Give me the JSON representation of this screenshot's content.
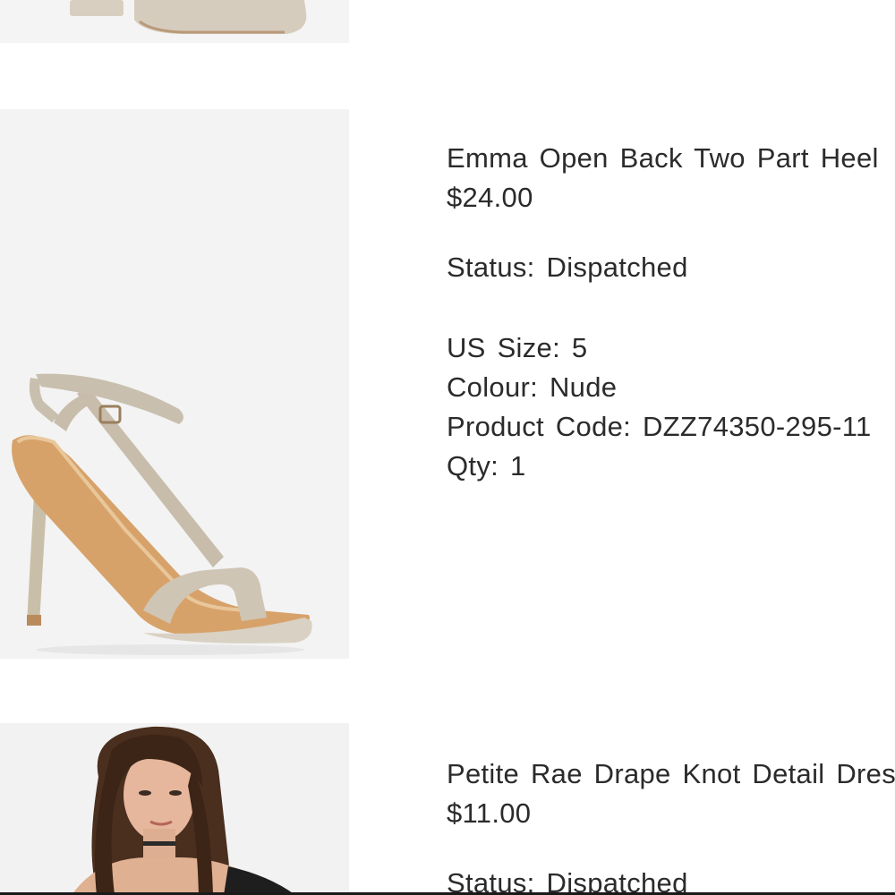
{
  "orders": [
    {
      "title": "Emma Open Back Two Part Heel",
      "price": "$24.00",
      "status_label": "Status:",
      "status_value": "Dispatched",
      "size_label": "US Size:",
      "size_value": "5",
      "colour_label": "Colour:",
      "colour_value": "Nude",
      "code_label": "Product Code:",
      "code_value": "DZZ74350-295-11",
      "qty_label": "Qty:",
      "qty_value": "1"
    },
    {
      "title": "Petite Rae Drape Knot Detail Dress",
      "price": "$11.00",
      "status_label": "Status:",
      "status_value": "Dispatched"
    }
  ]
}
